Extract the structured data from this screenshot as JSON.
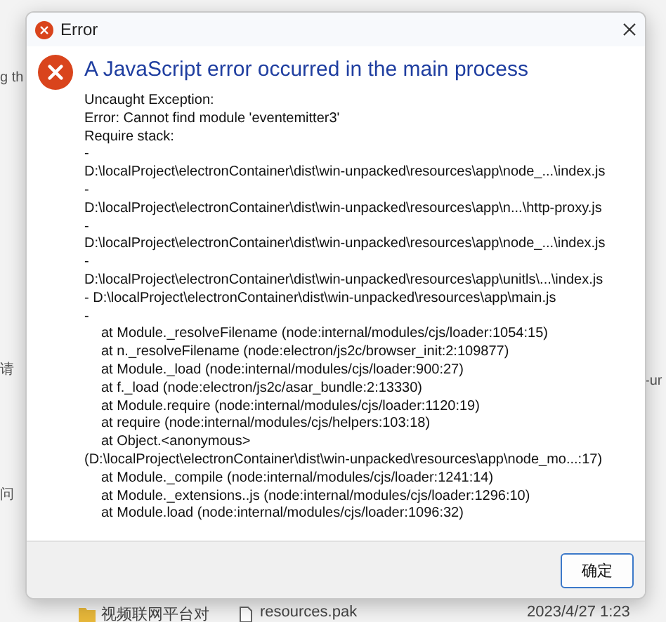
{
  "background": {
    "fragments": [
      {
        "text": "g th"
      },
      {
        "text": "请"
      },
      {
        "text": "问"
      },
      {
        "text": "-ur"
      }
    ],
    "file_row": {
      "folder": "视频联网平台对",
      "file": "resources.pak",
      "date": "2023/4/27 1:23"
    }
  },
  "dialog": {
    "title": "Error",
    "heading": "A JavaScript error occurred in the main process",
    "lines": [
      {
        "kind": "text",
        "text": "Uncaught Exception:"
      },
      {
        "kind": "text",
        "text": "Error: Cannot find module 'eventemitter3'"
      },
      {
        "kind": "text",
        "text": "Require stack:"
      },
      {
        "kind": "text",
        "text": "-"
      },
      {
        "kind": "text",
        "text": "D:\\localProject\\electronContainer\\dist\\win-unpacked\\resources\\app\\node_...\\index.js"
      },
      {
        "kind": "text",
        "text": "-"
      },
      {
        "kind": "text",
        "text": "D:\\localProject\\electronContainer\\dist\\win-unpacked\\resources\\app\\n...\\http-proxy.js"
      },
      {
        "kind": "text",
        "text": "-"
      },
      {
        "kind": "text",
        "text": "D:\\localProject\\electronContainer\\dist\\win-unpacked\\resources\\app\\node_...\\index.js"
      },
      {
        "kind": "text",
        "text": "-"
      },
      {
        "kind": "text",
        "text": "D:\\localProject\\electronContainer\\dist\\win-unpacked\\resources\\app\\unitls\\...\\index.js"
      },
      {
        "kind": "text",
        "text": "- D:\\localProject\\electronContainer\\dist\\win-unpacked\\resources\\app\\main.js"
      },
      {
        "kind": "text",
        "text": "-"
      },
      {
        "kind": "frame",
        "text": "at Module._resolveFilename (node:internal/modules/cjs/loader:1054:15)"
      },
      {
        "kind": "frame",
        "text": "at n._resolveFilename (node:electron/js2c/browser_init:2:109877)"
      },
      {
        "kind": "frame",
        "text": "at Module._load (node:internal/modules/cjs/loader:900:27)"
      },
      {
        "kind": "frame",
        "text": "at f._load (node:electron/js2c/asar_bundle:2:13330)"
      },
      {
        "kind": "frame",
        "text": "at Module.require (node:internal/modules/cjs/loader:1120:19)"
      },
      {
        "kind": "frame",
        "text": "at require (node:internal/modules/cjs/helpers:103:18)"
      },
      {
        "kind": "frame",
        "text": "at Object.<anonymous>"
      },
      {
        "kind": "text",
        "text": "(D:\\localProject\\electronContainer\\dist\\win-unpacked\\resources\\app\\node_mo...:17)"
      },
      {
        "kind": "frame",
        "text": "at Module._compile (node:internal/modules/cjs/loader:1241:14)"
      },
      {
        "kind": "frame",
        "text": "at Module._extensions..js (node:internal/modules/cjs/loader:1296:10)"
      },
      {
        "kind": "frame",
        "text": "at Module.load (node:internal/modules/cjs/loader:1096:32)"
      }
    ],
    "buttons": [
      "确定"
    ]
  }
}
